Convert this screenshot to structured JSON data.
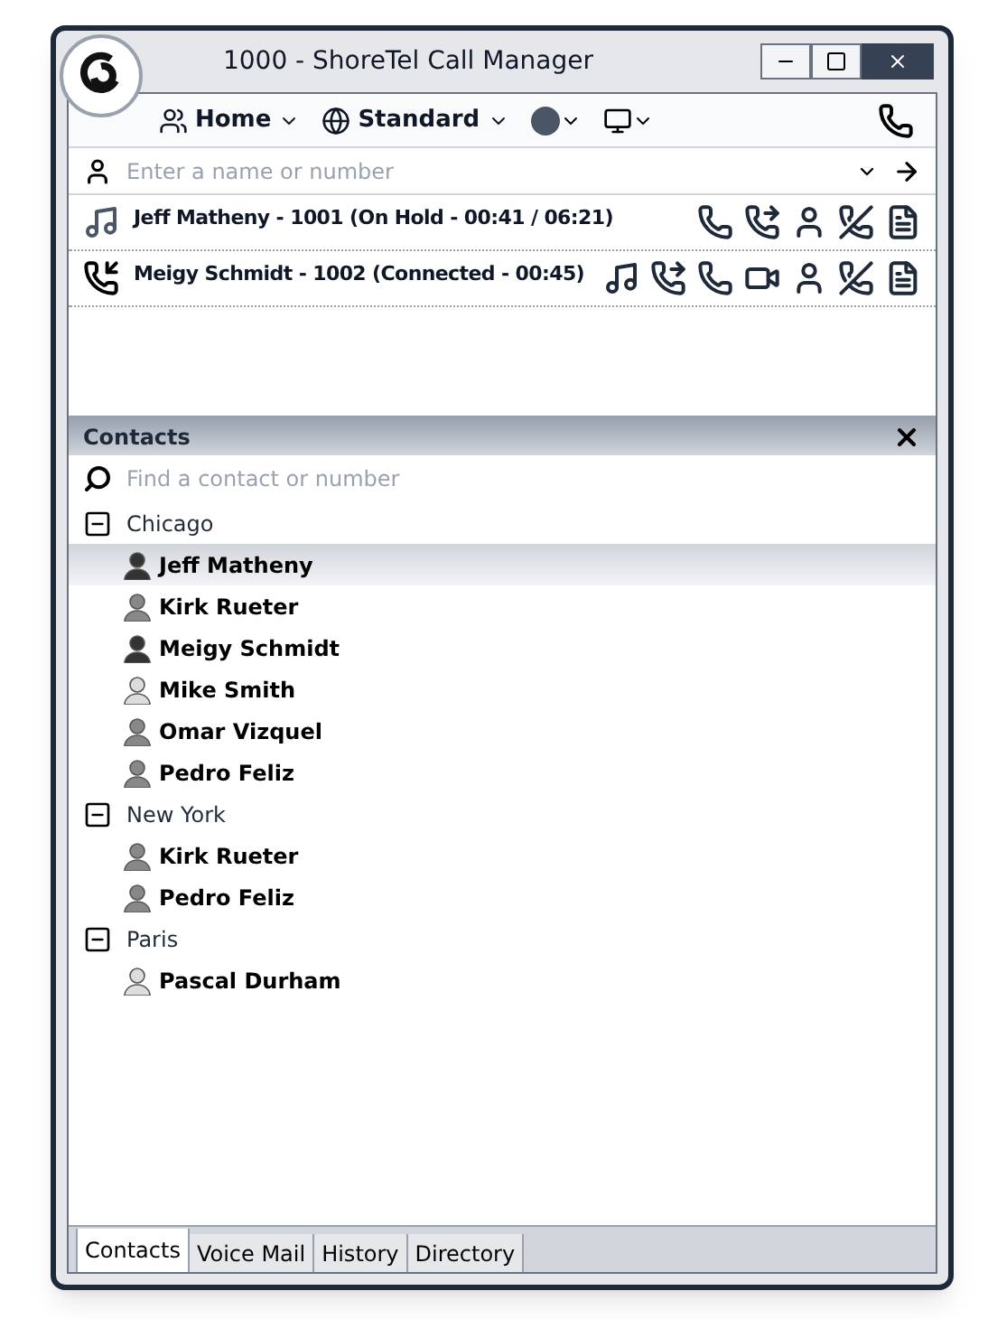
{
  "window": {
    "title": "1000 - ShoreTel Call Manager"
  },
  "toolbar": {
    "items": [
      {
        "label": "Home"
      },
      {
        "label": "Standard"
      }
    ]
  },
  "dial": {
    "placeholder": "Enter a name or number"
  },
  "calls": [
    {
      "kind": "hold",
      "text": "Jeff Matheny - 1001 (On Hold - 00:41 / 06:21)"
    },
    {
      "kind": "connected",
      "text": "Meigy Schmidt - 1002 (Connected - 00:45)"
    }
  ],
  "contacts": {
    "title": "Contacts",
    "search": {
      "placeholder": "Find a contact or number"
    },
    "groups": [
      {
        "name": "Chicago",
        "expanded": true,
        "children": [
          {
            "name": "Jeff Matheny",
            "color": "#333333",
            "selected": true
          },
          {
            "name": "Kirk Rueter",
            "color": "#888888",
            "selected": false
          },
          {
            "name": "Meigy Schmidt",
            "color": "#333333",
            "selected": false
          },
          {
            "name": "Mike Smith",
            "color": "#dddddd",
            "selected": false
          },
          {
            "name": "Omar Vizquel",
            "color": "#888888",
            "selected": false
          },
          {
            "name": "Pedro Feliz",
            "color": "#888888",
            "selected": false
          }
        ]
      },
      {
        "name": "New York",
        "expanded": true,
        "children": [
          {
            "name": "Kirk Rueter",
            "color": "#888888",
            "selected": false
          },
          {
            "name": "Pedro Feliz",
            "color": "#888888",
            "selected": false
          }
        ]
      },
      {
        "name": "Paris",
        "expanded": true,
        "children": [
          {
            "name": "Pascal Durham",
            "color": "#dddddd",
            "selected": false
          }
        ]
      }
    ]
  },
  "tabs": [
    {
      "label": "Contacts",
      "selected": true
    },
    {
      "label": "Voice Mail",
      "selected": false
    },
    {
      "label": "History",
      "selected": false
    },
    {
      "label": "Directory",
      "selected": false
    }
  ]
}
